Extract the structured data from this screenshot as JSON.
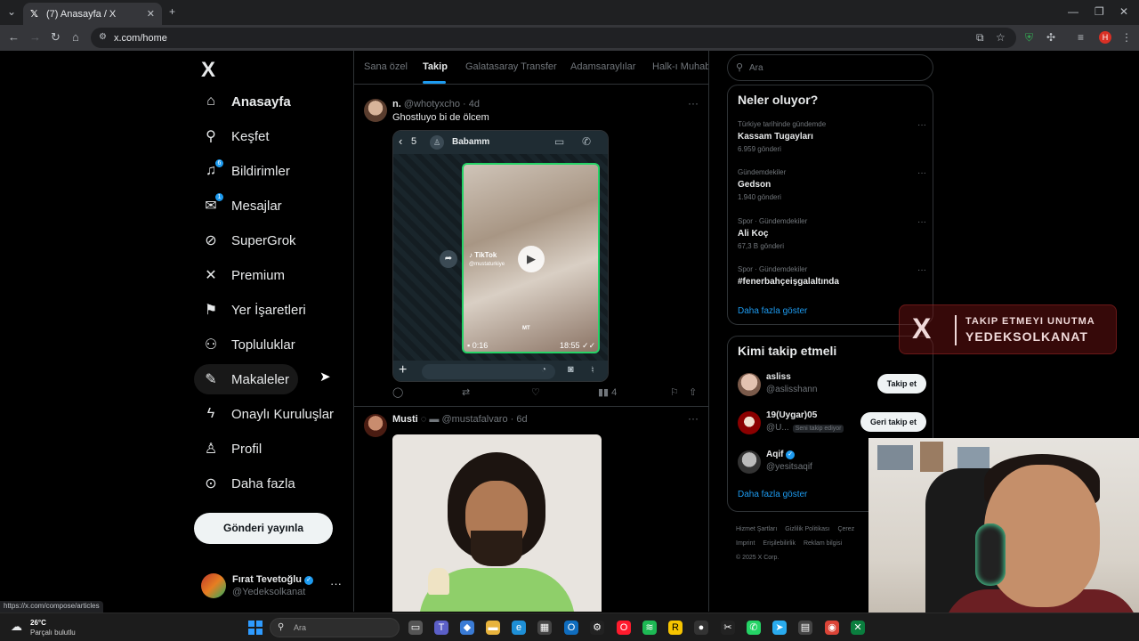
{
  "browser": {
    "tab_title": "(7) Anasayfa / X",
    "url": "x.com/home",
    "status_url": "https://x.com/compose/articles",
    "profile_letter": "H"
  },
  "sidebar": {
    "logo": "X",
    "items": [
      {
        "label": "Anasayfa",
        "icon": "home-icon",
        "glyph": "⌂",
        "active": true
      },
      {
        "label": "Keşfet",
        "icon": "search-icon",
        "glyph": "⚲"
      },
      {
        "label": "Bildirimler",
        "icon": "bell-icon",
        "glyph": "♫",
        "badge": "6"
      },
      {
        "label": "Mesajlar",
        "icon": "mail-icon",
        "glyph": "✉",
        "badge": "1"
      },
      {
        "label": "SuperGrok",
        "icon": "grok-icon",
        "glyph": "⊘"
      },
      {
        "label": "Premium",
        "icon": "x-premium-icon",
        "glyph": "✕"
      },
      {
        "label": "Yer İşaretleri",
        "icon": "bookmark-icon",
        "glyph": "⚑"
      },
      {
        "label": "Topluluklar",
        "icon": "communities-icon",
        "glyph": "⚇"
      },
      {
        "label": "Makaleler",
        "icon": "articles-icon",
        "glyph": "✎"
      },
      {
        "label": "Onaylı Kuruluşlar",
        "icon": "lightning-icon",
        "glyph": "ϟ"
      },
      {
        "label": "Profil",
        "icon": "profile-icon",
        "glyph": "♙"
      },
      {
        "label": "Daha fazla",
        "icon": "more-circle-icon",
        "glyph": "⊙"
      }
    ],
    "post_button": "Gönderi yayınla",
    "account": {
      "name": "Fırat Tevetoğlu",
      "handle": "@Yedeksolkanat"
    }
  },
  "feed": {
    "tabs": [
      "Sana özel",
      "Takip",
      "Galatasaray Transfer",
      "Adamsaraylılar",
      "Halk-ı Muhab"
    ],
    "active_tab": "Takip",
    "posts": [
      {
        "name": "n.",
        "handle": "@whotyxcho",
        "time": "4d",
        "text": "Ghostluyo bi de ölcem",
        "media": {
          "back_count": "5",
          "contact": "Babamm",
          "watermark": "TikTok",
          "sub_watermark": "@mustaturkiye",
          "duration": "0:16",
          "sent_time": "18:55",
          "mt_label": "MT"
        },
        "views": "4"
      },
      {
        "name": "Musti",
        "handle": "@mustafalvaro",
        "time": "6d"
      }
    ]
  },
  "right": {
    "search_placeholder": "Ara",
    "trends_title": "Neler oluyor?",
    "trends": [
      {
        "context": "Türkiye tarihinde gündemde",
        "title": "Kassam Tugayları",
        "count": "6.959 gönderi"
      },
      {
        "context": "Gündemdekiler",
        "title": "Gedson",
        "count": "1.940 gönderi"
      },
      {
        "context": "Spor · Gündemdekiler",
        "title": "Ali Koç",
        "count": "67,3 B gönderi"
      },
      {
        "context": "Spor · Gündemdekiler",
        "title": "#fenerbahçeişgalaltında",
        "count": ""
      }
    ],
    "show_more": "Daha fazla göster",
    "who_title": "Kimi takip etmeli",
    "who": [
      {
        "name": "asliss",
        "handle": "@aslisshann",
        "button": "Takip et",
        "tag": ""
      },
      {
        "name": "19(Uygar)05",
        "handle": "@U...",
        "button": "Geri takip et",
        "tag": "Seni takip ediyor"
      },
      {
        "name": "Aqif",
        "handle": "@yesitsaqif",
        "button": "",
        "tag": ""
      }
    ],
    "who_more": "Daha fazla göster",
    "footer": [
      "Hizmet Şartları",
      "Gizlilik Politikası",
      "Çerez",
      "Imprint",
      "Erişilebilirlik",
      "Reklam bilgisi",
      "© 2025 X Corp."
    ]
  },
  "overlay": {
    "line1": "TAKIP ETMEYI UNUTMA",
    "line2": "YEDEKSOLKANAT"
  },
  "taskbar": {
    "temp": "26°C",
    "weather": "Parçalı bulutlu",
    "search_placeholder": "Ara"
  }
}
